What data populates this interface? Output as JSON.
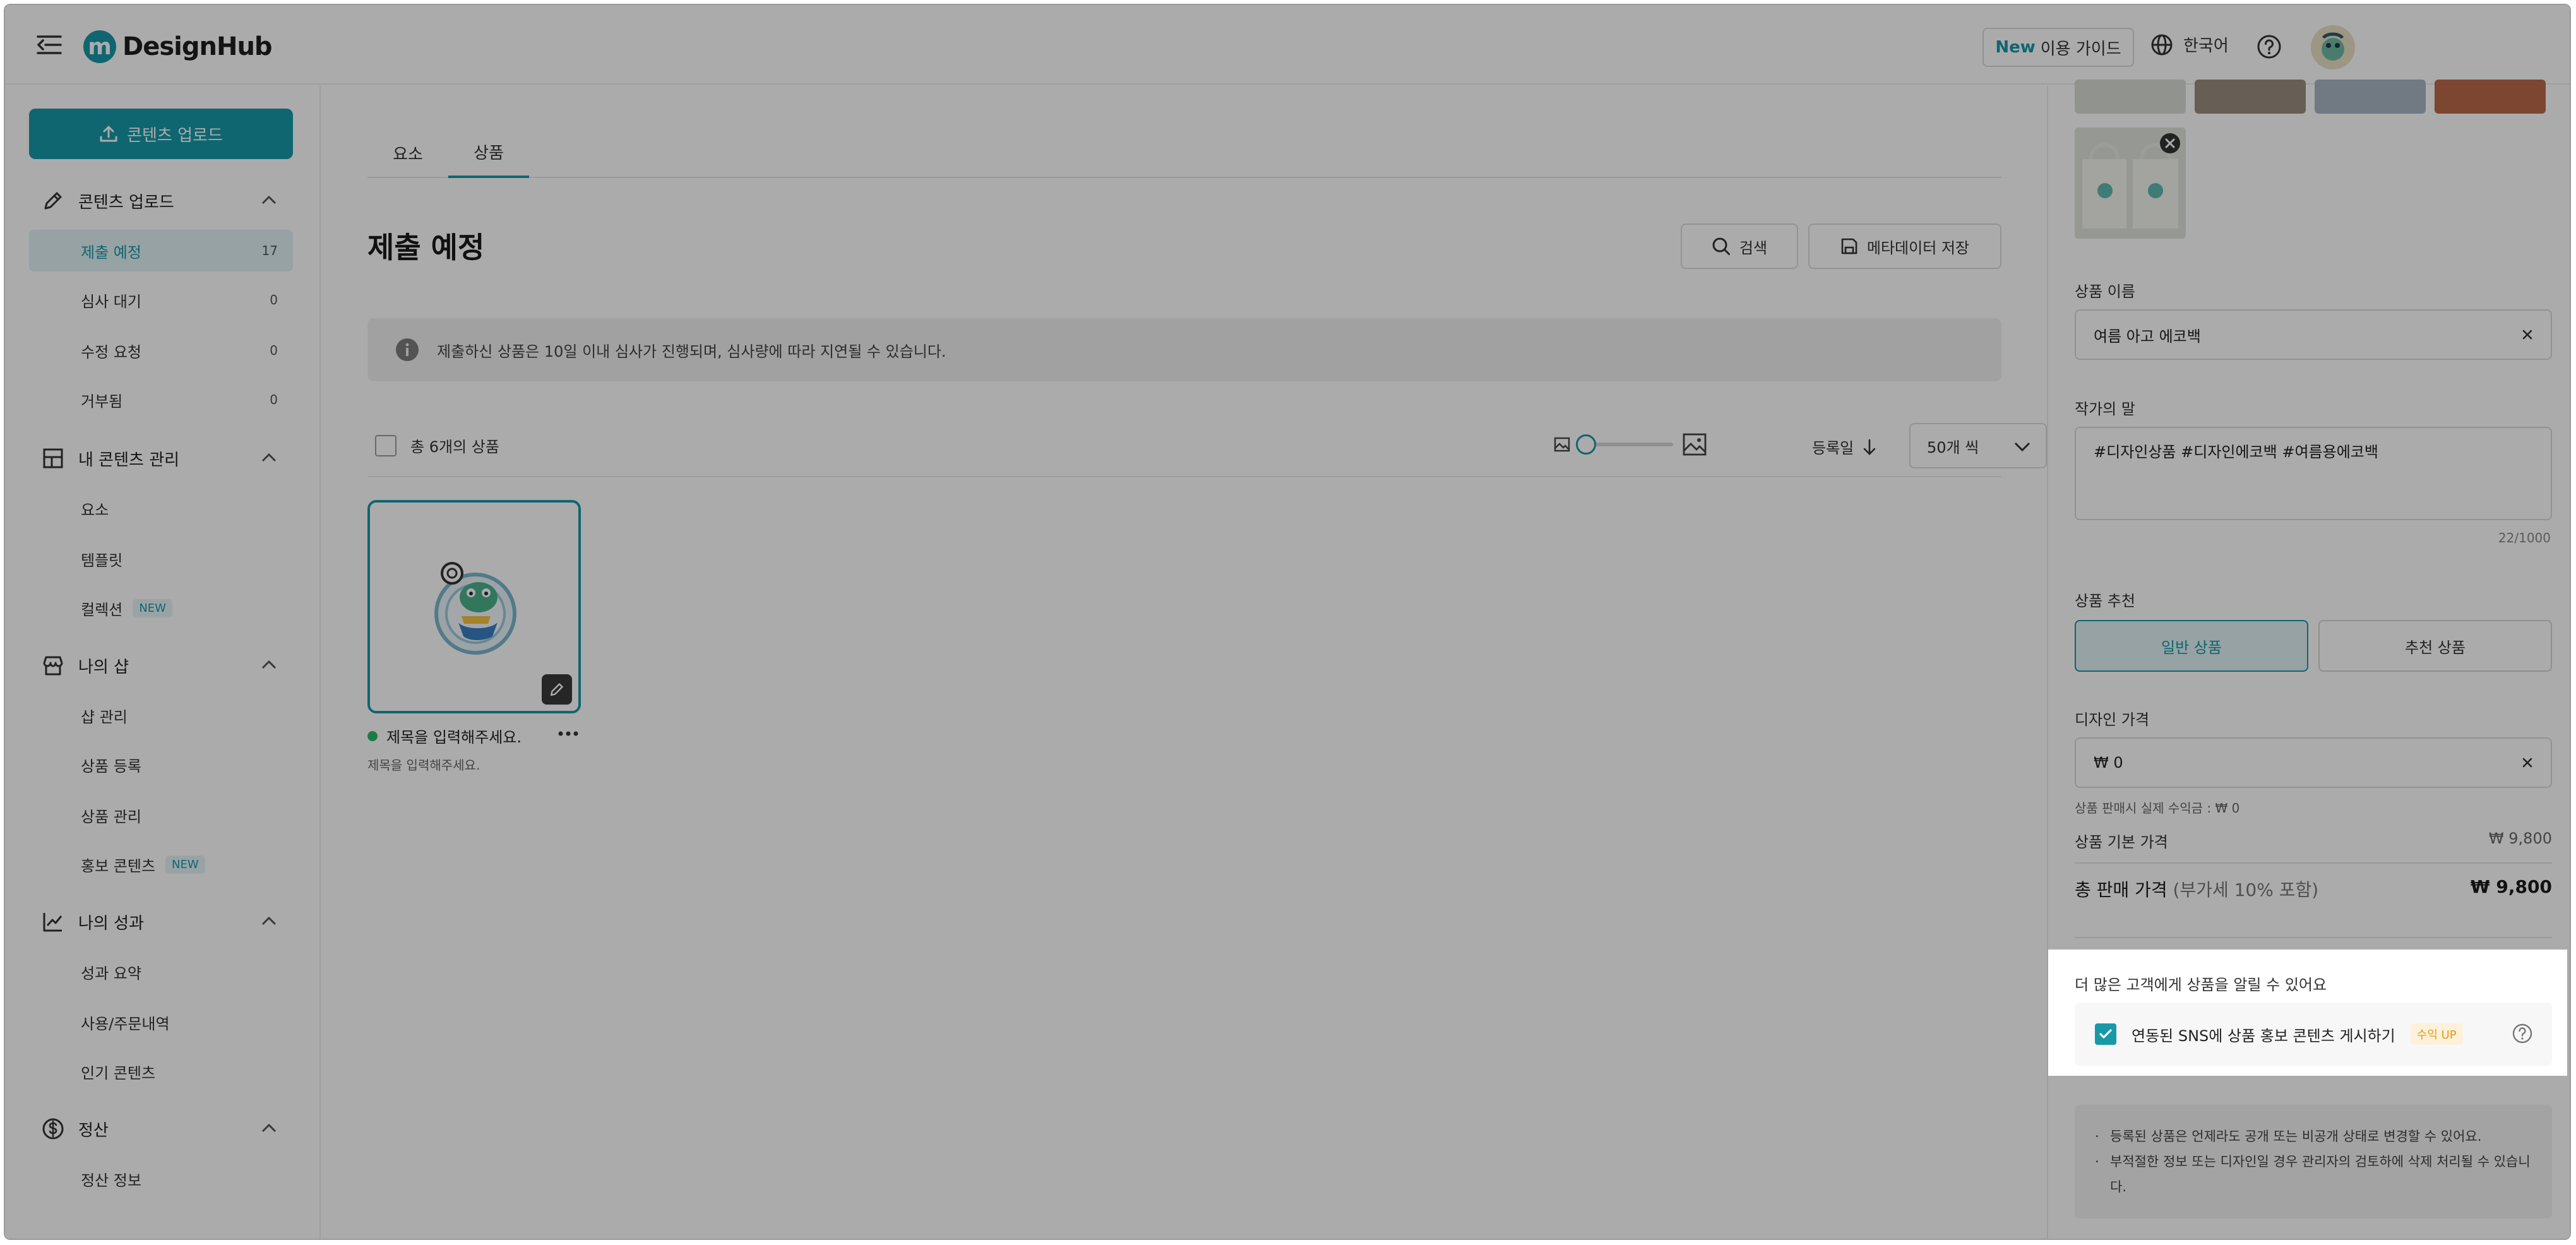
{
  "header": {
    "brand": "DesignHub",
    "logo_letter": "m",
    "guide_new": "New",
    "guide_label": "이용 가이드",
    "language": "한국어"
  },
  "sidebar": {
    "upload_button": "콘텐츠 업로드",
    "sections": [
      {
        "title": "콘텐츠 업로드",
        "items": [
          {
            "label": "제출 예정",
            "count": "17"
          },
          {
            "label": "심사 대기",
            "count": "0"
          },
          {
            "label": "수정 요청",
            "count": "0"
          },
          {
            "label": "거부됨",
            "count": "0"
          }
        ]
      },
      {
        "title": "내 콘텐츠 관리",
        "items": [
          {
            "label": "요소"
          },
          {
            "label": "템플릿"
          },
          {
            "label": "컬렉션",
            "badge": "NEW"
          }
        ]
      },
      {
        "title": "나의 샵",
        "items": [
          {
            "label": "샵 관리"
          },
          {
            "label": "상품 등록"
          },
          {
            "label": "상품 관리"
          },
          {
            "label": "홍보 콘텐츠",
            "badge": "NEW"
          }
        ]
      },
      {
        "title": "나의 성과",
        "items": [
          {
            "label": "성과 요약"
          },
          {
            "label": "사용/주문내역"
          },
          {
            "label": "인기 콘텐츠"
          }
        ]
      },
      {
        "title": "정산",
        "items": [
          {
            "label": "정산 정보"
          }
        ]
      }
    ]
  },
  "main": {
    "tabs": [
      {
        "label": "요소"
      },
      {
        "label": "상품"
      }
    ],
    "title": "제출 예정",
    "search_label": "검색",
    "save_meta_label": "메타데이터 저장",
    "notice": "제출하신 상품은 10일 이내 심사가 진행되며, 심사량에 따라 지연될 수 있습니다.",
    "total_label": "총 6개의 상품",
    "sort_label": "등록일",
    "per_page": "50개 씩",
    "card": {
      "title": "제목을 입력해주세요.",
      "subtitle": "제목을 입력해주세요."
    }
  },
  "panel": {
    "name_label": "상품 이름",
    "name_value": "여름 아고 에코백",
    "author_label": "작가의 말",
    "author_value": "#디자인상품 #디자인에코백 #여름용에코백",
    "author_count": "22/1000",
    "rec_label": "상품 추천",
    "rec_general": "일반 상품",
    "rec_recommended": "추천 상품",
    "price_label": "디자인 가격",
    "price_value": "₩ 0",
    "profit_note": "상품 판매시 실제 수익금 : ₩ 0",
    "base_price_label": "상품 기본 가격",
    "base_price_value": "₩ 9,800",
    "total_price_label": "총 판매 가격",
    "total_price_note": "(부가세 10% 포함)",
    "total_price_value": "₩ 9,800",
    "promo_heading": "더 많은 고객에게 상품을 알릴 수 있어요",
    "promo_label": "연동된 SNS에 상품 홍보 콘텐츠 게시하기",
    "promo_badge": "수익 UP",
    "info_lines": [
      "등록된 상품은 언제라도 공개 또는 비공개 상태로 변경할 수 있어요.",
      "부적절한 정보 또는 디자인일 경우 관리자의 검토하에 삭제 처리될 수 있습니다."
    ]
  },
  "colors": {
    "accent": "#1799a8",
    "status_green": "#2eb86b",
    "profit_orange": "#e39a14"
  }
}
